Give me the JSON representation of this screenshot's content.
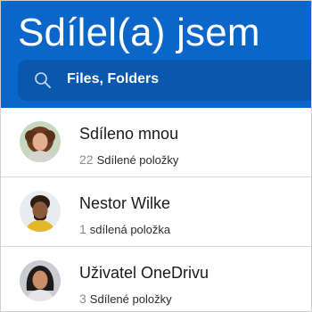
{
  "header": {
    "title": "Sdílel(a) jsem",
    "background": "#0a66c8"
  },
  "search": {
    "placeholder": "Files, Folders",
    "icon": "search-icon"
  },
  "items": [
    {
      "name": "Sdíleno mnou",
      "count": "22",
      "label": "Sdílené položky",
      "avatar": "avatar-woman-curly-hair"
    },
    {
      "name": "Nestor Wilke",
      "count": "1",
      "label": "sdílená položka",
      "avatar": "avatar-man-yellow-shirt"
    },
    {
      "name": "Uživatel OneDrivu",
      "count": "3",
      "label": "Sdílené položky",
      "avatar": "avatar-woman-dark-hair"
    }
  ]
}
